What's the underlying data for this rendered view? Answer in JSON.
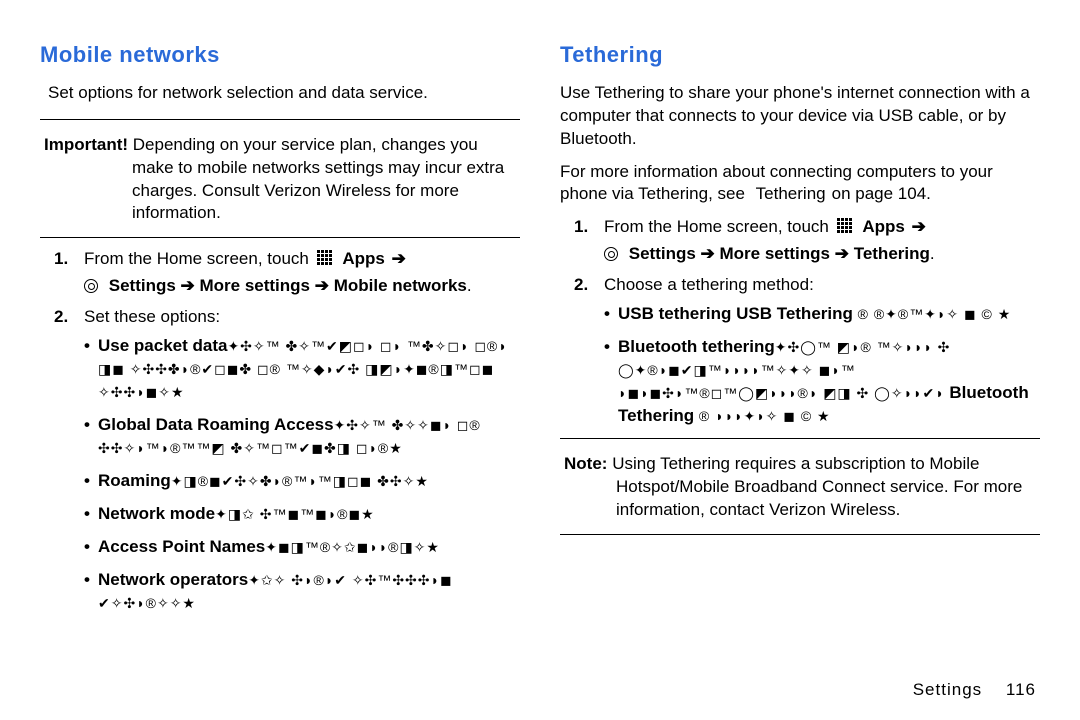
{
  "left": {
    "title": "Mobile networks",
    "intro": "Set options for network selection and data service.",
    "important_label": "Important!",
    "important_body": "Depending on your service plan, changes you make to mobile networks settings may incur extra charges. Consult Verizon Wireless for more information.",
    "step1": {
      "num": "1.",
      "prefix": "From the Home screen, touch",
      "apps": "Apps",
      "arrow": "➔",
      "path": "Settings ➔ More settings ➔ Mobile networks",
      "tail": "."
    },
    "step2": {
      "num": "2.",
      "text": "Set these options:"
    },
    "options": [
      {
        "label": "Use packet data",
        "glyphs": "✦✣✧™ ✤✧™✔◩◻◗ ◻◗ ™✤✧◻◗ ◻®◗ ◨◼ ✧✣✣✤◗®✔◻◼✤ ◻® ™✧◆◗✔✣ ◨◩◗✦◼®◨™◻◼ ✧✣✣◗◼✧★"
      },
      {
        "label": "Global Data Roaming Access",
        "glyphs": "✦✣✧™ ✤✧✧◼◗ ◻® ✣✣✧◗™◗®™™◩ ✤✧™◻™✔◼✤◨ ◻◗®★"
      },
      {
        "label": "Roaming",
        "glyphs": "✦◨®◼✔✣✧✤◗®™◗™◨◻◼ ✤✣✧★"
      },
      {
        "label": "Network mode",
        "glyphs": "✦◨✩ ✣™◼™◼◗®◼★"
      },
      {
        "label": "Access Point Names",
        "glyphs": "✦◼◨™®✧✩◼◗◗®◨✧★"
      },
      {
        "label": "Network operators",
        "glyphs": "✦✩✧ ✣◗®◗✔ ✧✣™✣✣✣◗◼ ✔✧✣◗®✧✧★"
      }
    ]
  },
  "right": {
    "title": "Tethering",
    "intro": "Use Tethering to share your phone's internet connection with a computer that connects to your device via USB cable, or by Bluetooth.",
    "more_prefix": "For more information about connecting computers to your phone via Tethering, see",
    "more_link": "Tethering",
    "more_suffix": "on page 104.",
    "step1": {
      "num": "1.",
      "prefix": "From the Home screen, touch",
      "apps": "Apps",
      "arrow": "➔",
      "path": "Settings ➔ More settings ➔ Tethering",
      "tail": "."
    },
    "step2": {
      "num": "2.",
      "text": "Choose a tethering method:"
    },
    "options": [
      {
        "label": "USB tethering",
        "glyphs_pre": "✦◼◗◨™◗◗®® ™✧◩ ◼✣✣◯ ✧™✧® ◗",
        "sublabel": "USB Tethering",
        "glyphs_post": "® ®✦®™✦◗✧ ◼ © ★"
      },
      {
        "label": "Bluetooth tethering",
        "glyphs_pre": "✦✣◯™ ◩◗® ™✧◗◗◗ ✣ ◯✦®◗◼✔◨™◗◗◗◗™✧✦✧ ◼◗™ ◗◼◗◼✣◗™®◻™◯◩◗◗◗®◗ ◩◨ ✣ ◯✧◗◗✔◗",
        "sublabel": "Bluetooth Tethering",
        "glyphs_post": "® ◗◗◗✦◗✧ ◼ © ★"
      }
    ],
    "note_label": "Note:",
    "note_body": "Using Tethering requires a subscription to Mobile Hotspot/Mobile Broadband Connect service. For more information, contact Verizon Wireless."
  },
  "footer": {
    "section": "Settings",
    "page": "116"
  }
}
